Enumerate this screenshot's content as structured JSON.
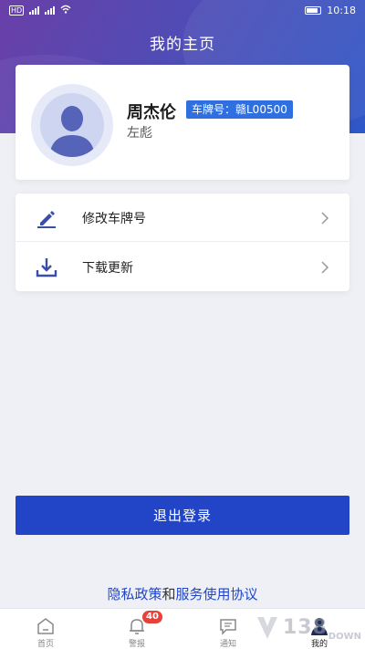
{
  "status_bar": {
    "left_text": "HD",
    "time": "10:18"
  },
  "header": {
    "title": "我的主页"
  },
  "profile": {
    "name": "周杰伦",
    "plate_label": "车牌号：赣L00500",
    "role": "左彪"
  },
  "menu": {
    "items": [
      {
        "label": "修改车牌号",
        "icon": "edit-icon"
      },
      {
        "label": "下载更新",
        "icon": "download-icon"
      }
    ]
  },
  "logout": {
    "label": "退出登录"
  },
  "policy": {
    "privacy": "隐私政策",
    "and": "和",
    "service": "服务使用协议"
  },
  "tabbar": {
    "tabs": [
      {
        "label": "首页",
        "icon": "home-icon"
      },
      {
        "label": "警报",
        "icon": "bell-icon",
        "badge": "40"
      },
      {
        "label": "通知",
        "icon": "message-icon"
      },
      {
        "label": "我的",
        "icon": "user-icon",
        "active": true
      }
    ]
  },
  "watermark": {
    "text": "138",
    "small": "DOWN"
  },
  "colors": {
    "primary": "#2245c8",
    "badge": "#e6413a",
    "plate": "#2f6fe0"
  }
}
